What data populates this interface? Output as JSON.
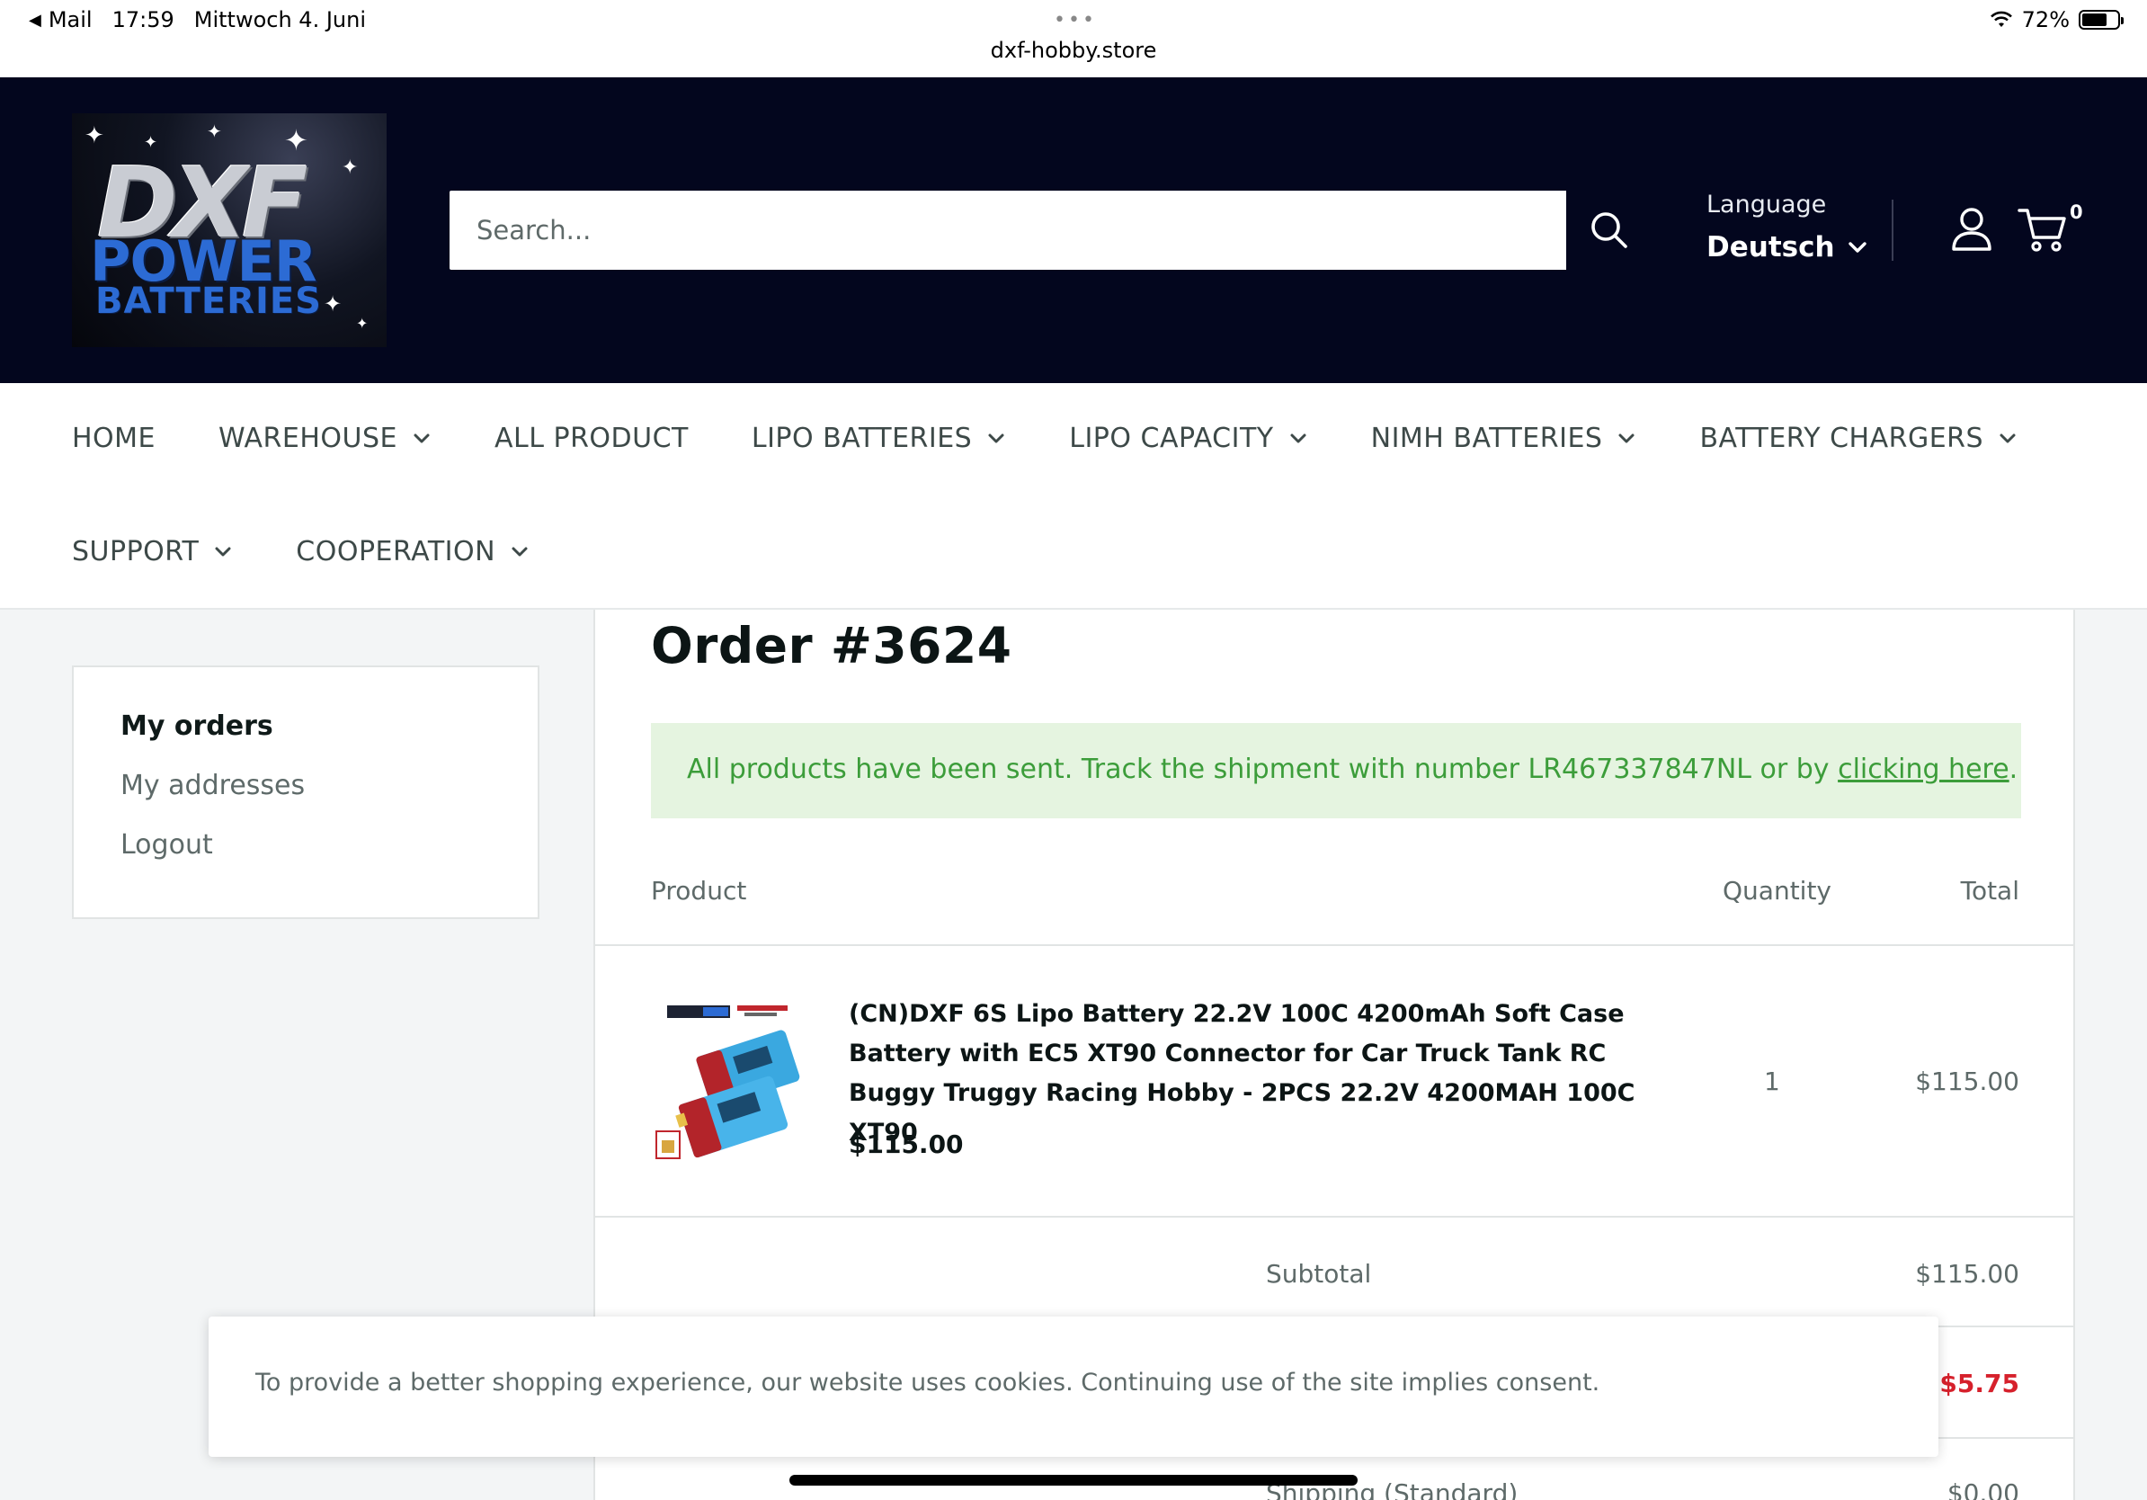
{
  "status_bar": {
    "back_app": "Mail",
    "time": "17:59",
    "date": "Mittwoch 4. Juni",
    "url": "dxf-hobby.store",
    "battery": "72%"
  },
  "header": {
    "logo_line1": "DXF",
    "logo_line2": "POWER",
    "logo_line3": "BATTERIES",
    "search_placeholder": "Search...",
    "language_label": "Language",
    "language_value": "Deutsch",
    "cart_count": "0"
  },
  "nav": {
    "row1": [
      {
        "label": "HOME",
        "dropdown": false
      },
      {
        "label": "WAREHOUSE",
        "dropdown": true
      },
      {
        "label": "ALL PRODUCT",
        "dropdown": false
      },
      {
        "label": "LIPO BATTERIES",
        "dropdown": true
      },
      {
        "label": "LIPO CAPACITY",
        "dropdown": true
      },
      {
        "label": "NIMH BATTERIES",
        "dropdown": true
      },
      {
        "label": "BATTERY CHARGERS",
        "dropdown": true
      }
    ],
    "row2": [
      {
        "label": "SUPPORT",
        "dropdown": true
      },
      {
        "label": "COOPERATION",
        "dropdown": true
      }
    ]
  },
  "sidebar": {
    "items": [
      {
        "label": "My orders",
        "active": true
      },
      {
        "label": "My addresses",
        "active": false
      },
      {
        "label": "Logout",
        "active": false
      }
    ]
  },
  "order": {
    "title": "Order #3624",
    "notice_text": "All products have been sent. Track the shipment with number LR467337847NL or by ",
    "notice_link": "clicking here",
    "notice_end": ".",
    "columns": {
      "product": "Product",
      "quantity": "Quantity",
      "total": "Total"
    },
    "items": [
      {
        "name": "(CN)DXF 6S Lipo Battery 22.2V 100C 4200mAh Soft Case Battery with EC5 XT90 Connector for Car Truck Tank RC Buggy Truggy Racing Hobby - 2PCS 22.2V 4200MAH 100C XT90",
        "price": "$115.00",
        "quantity": "1",
        "total": "$115.00"
      }
    ],
    "summary": {
      "subtotal_label": "Subtotal",
      "subtotal_value": "$115.00",
      "discount_value": "-$5.75",
      "shipping_label": "Shipping (Standard)",
      "shipping_value": "$0.00"
    }
  },
  "cookie_notice": "To provide a better shopping experience, our website uses cookies. Continuing use of the site implies consent.",
  "colors": {
    "header_bg": "#03061e",
    "notice_bg": "#e5f4e0",
    "notice_text": "#3c9d3a",
    "discount": "#d6212c"
  }
}
